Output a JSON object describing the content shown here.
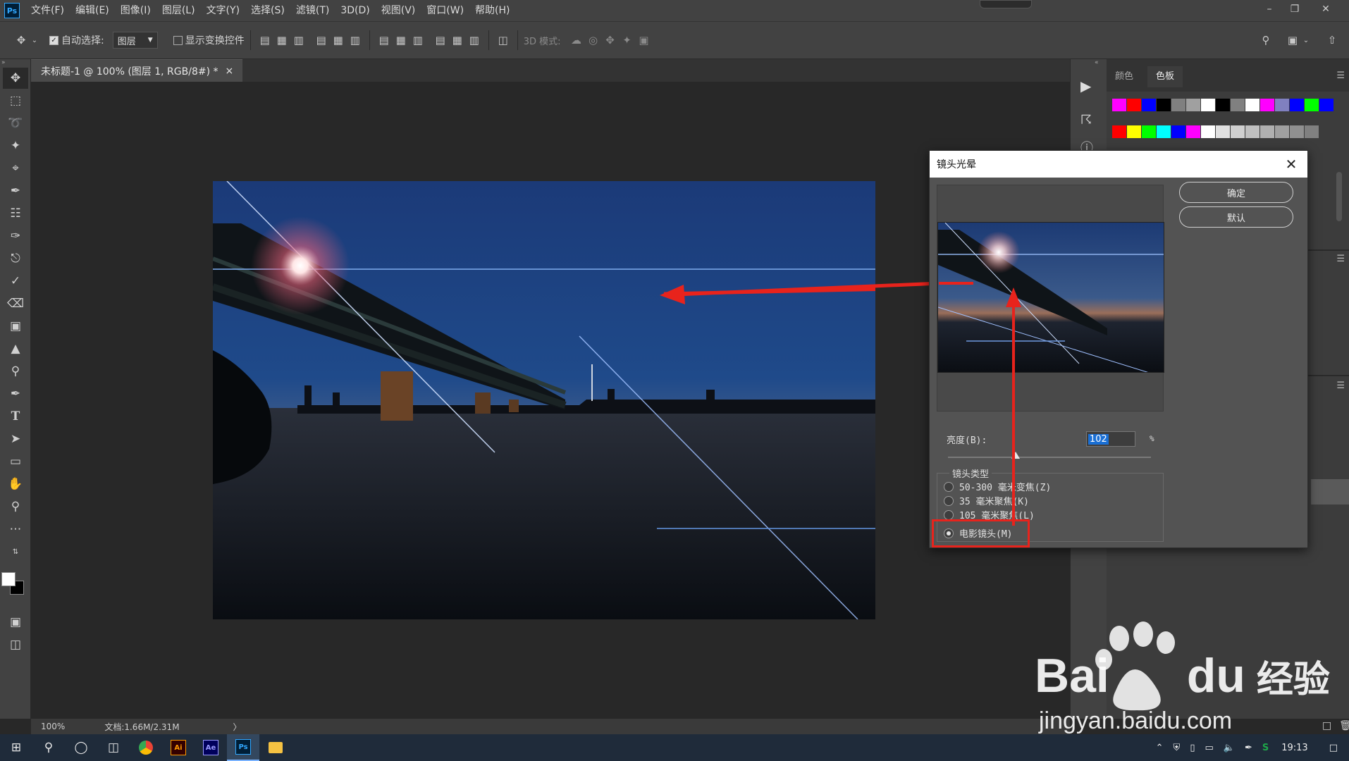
{
  "app": {
    "logo": "Ps"
  },
  "menu": [
    "文件(F)",
    "编辑(E)",
    "图像(I)",
    "图层(L)",
    "文字(Y)",
    "选择(S)",
    "滤镜(T)",
    "3D(D)",
    "视图(V)",
    "窗口(W)",
    "帮助(H)"
  ],
  "options": {
    "auto_select_label": "自动选择:",
    "auto_select_checked": true,
    "layer_select_value": "图层",
    "show_transform_label": "显示变换控件",
    "mode_3d_label": "3D 模式:"
  },
  "document": {
    "tab_title": "未标题-1 @ 100% (图层 1, RGB/8#) *",
    "close_glyph": "×"
  },
  "status": {
    "zoom": "100%",
    "doc_info": "文档:1.66M/2.31M",
    "arrow": "〉"
  },
  "swatches_panel": {
    "tabs": [
      "颜色",
      "色板"
    ],
    "active_tab": "色板",
    "row1": [
      "#ff00ff",
      "#ff0000",
      "#0000ff",
      "#000000",
      "#808080",
      "#a0a0a0",
      "#ffffff",
      "#000000",
      "#808080",
      "#ffffff",
      "#ff00ff",
      "#8080c0",
      "#0000ff",
      "#00ff00",
      "#0000ff"
    ],
    "row2": [
      "#ff0000",
      "#ffff00",
      "#00ff00",
      "#00ffff",
      "#0000ff",
      "#ff00ff",
      "#ffffff",
      "#e0e0e0",
      "#d0d0d0",
      "#c0c0c0",
      "#b0b0b0",
      "#a0a0a0",
      "#909090",
      "#808080"
    ]
  },
  "dialog": {
    "title": "镜头光晕",
    "ok_label": "确定",
    "default_label": "默认",
    "brightness_label": "亮度(B):",
    "brightness_value": "102",
    "brightness_unit": "%",
    "brightness_level": 102,
    "lens_group_title": "镜头类型",
    "lens_options": [
      "50-300 毫米变焦(Z)",
      "35 毫米聚焦(K)",
      "105 毫米聚焦(L)",
      "电影镜头(M)"
    ],
    "selected_lens": "电影镜头(M)"
  },
  "taskbar": {
    "time": "19:13",
    "apps": [
      "Ai",
      "Ae",
      "Ps"
    ]
  },
  "watermark": {
    "brand": "Bai",
    "brand2": "du",
    "cn": "经验",
    "url": "jingyan.baidu.com"
  },
  "colors": {
    "accent_red": "#e8231c",
    "ps_blue": "#31a8ff"
  }
}
